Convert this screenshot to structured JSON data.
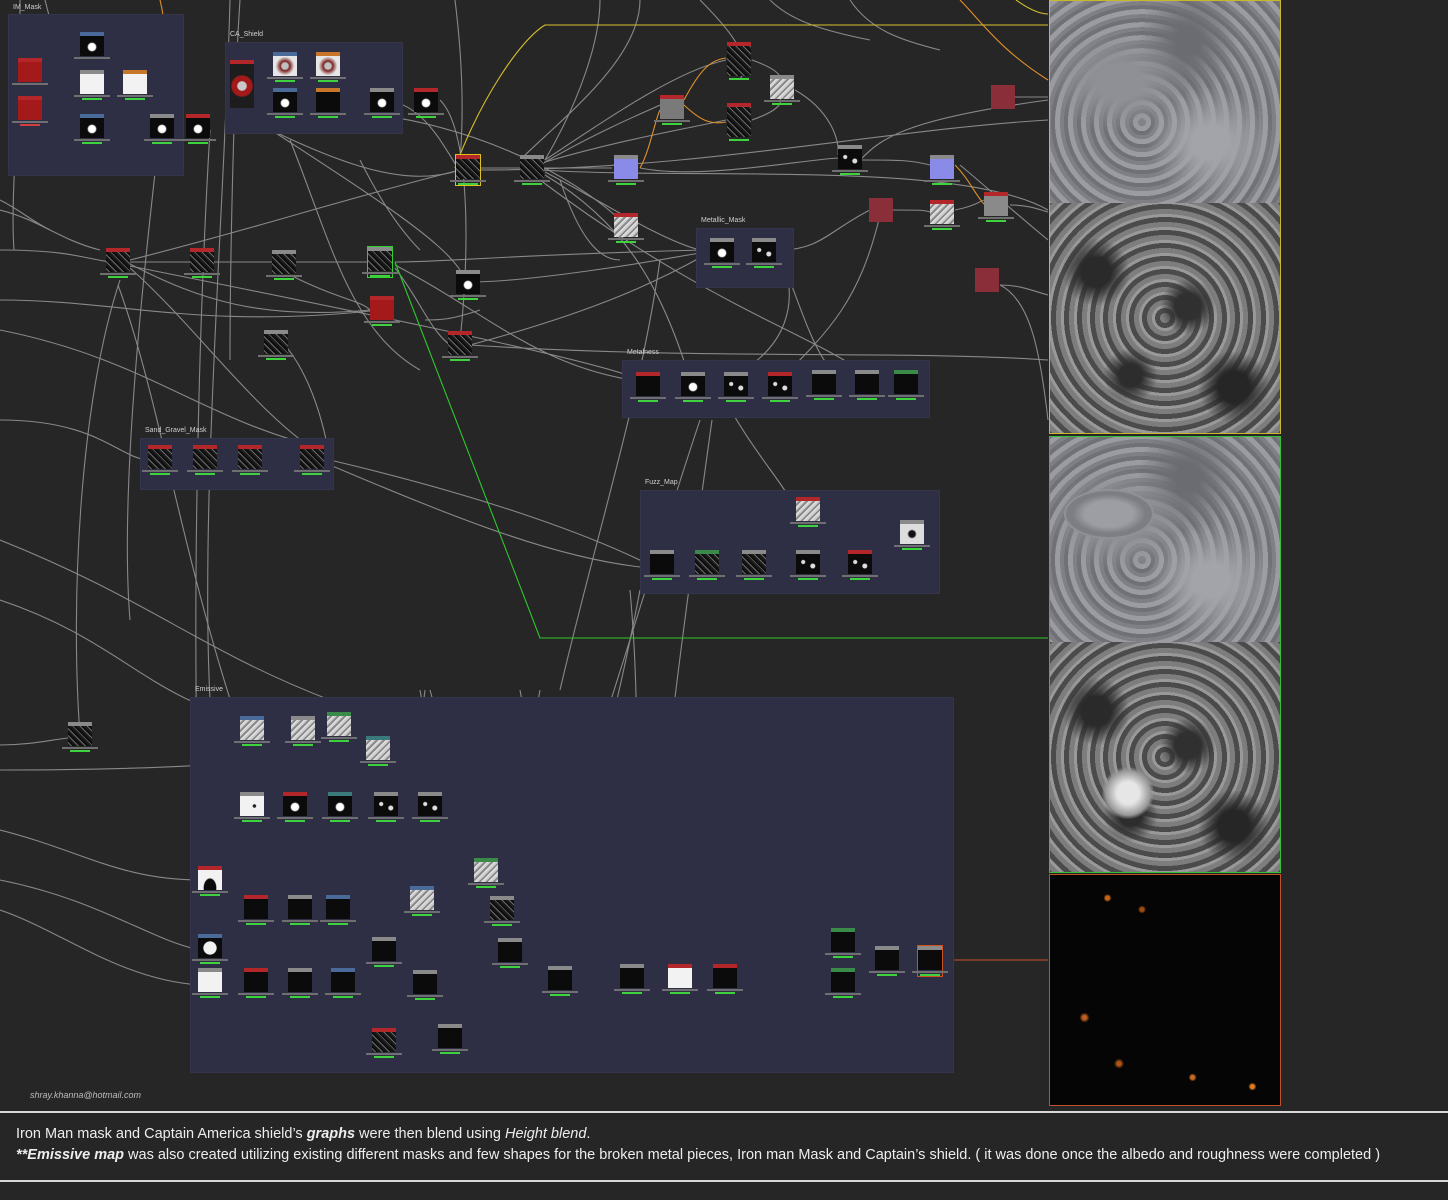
{
  "frames": {
    "im_mask": "IM_Mask",
    "ca_shield": "CA_Shield",
    "metallic_mask": "Metallic_Mask",
    "metalness": "Metalness",
    "sand_gravel_mask": "Sand_Gravel_Mask",
    "fuzz_map": "Fuzz_Map",
    "emissive": "Emissive"
  },
  "author_email": "shray.khanna@hotmail.com",
  "caption": {
    "line1_part1": "Iron Man mask and Captain America shield’s ",
    "line1_graphs": "graphs",
    "line1_part2": " were then blend using ",
    "line1_height_blend": "Height blend",
    "line1_end": ".",
    "line2_bold": "**Emissive map",
    "line2_rest": " was also created utilizing existing different masks and few shapes for the broken metal pieces, Iron man Mask and Captain’s shield. ( it was done once the albedo and roughness were completed )"
  },
  "colors": {
    "background": "#262626",
    "frame": "#2e2e44",
    "wire": "#9a9a9a",
    "wire_orange": "#e0902a",
    "height_preview_border": "#c8b82a",
    "blend_preview_border": "#34c034",
    "emissive_preview_border": "#c0502a",
    "status_text": "#3fd23f"
  },
  "previews": [
    {
      "name": "height-albedo-roughness-preview"
    },
    {
      "name": "height-blend-result-preview"
    },
    {
      "name": "emissive-map-preview"
    }
  ]
}
